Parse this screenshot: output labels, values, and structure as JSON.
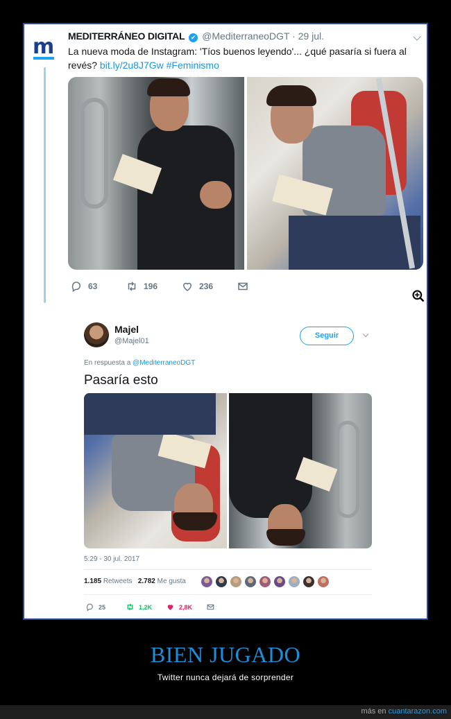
{
  "tweet1": {
    "display_name": "MEDITERRÁNEO DIGITAL",
    "handle": "@MediterraneoDGT",
    "date": "· 29 jul.",
    "text_before": "La nueva moda de Instagram: 'Tíos buenos leyendo'... ¿qué pasaría si fuera al revés? ",
    "link": "bit.ly/2u8J7Gw",
    "hashtag": "#Feminismo",
    "replies": "63",
    "retweets": "196",
    "likes": "236",
    "verified_icon": "✔",
    "brand_color": "#1b3f8b",
    "logo_letter": "m"
  },
  "tweet2": {
    "display_name": "Majel",
    "handle": "@Majel01",
    "follow_label": "Seguir",
    "reply_to_prefix": "En respuesta a ",
    "reply_to_handle": "@MediterraneoDGT",
    "text": "Pasaría esto",
    "timestamp": "5:29 - 30 jul. 2017",
    "retweets_count": "1.185",
    "retweets_label": "Retweets",
    "likes_count": "2.782",
    "likes_label": "Me gusta",
    "replies": "25",
    "retweets_short": "1,2K",
    "likes_short": "2,8K",
    "liker_colors": [
      "#7c5a9a",
      "#2f3b4a",
      "#b59c7a",
      "#5a6a7a",
      "#a05a7a",
      "#6a4a8a",
      "#9ab0c0",
      "#3a3030",
      "#c07060"
    ]
  },
  "caption": {
    "title": "BIEN JUGADO",
    "subtitle": "Twitter nunca dejará de sorprender"
  },
  "footer": {
    "prefix": "más en ",
    "site": "cuantarazon.com"
  },
  "colors": {
    "accent_blue": "#1da1f2",
    "link_blue": "#1b95e0",
    "like_pink": "#e0245e",
    "retweet_green": "#17bf63",
    "caption_blue": "#1c8fd8"
  }
}
